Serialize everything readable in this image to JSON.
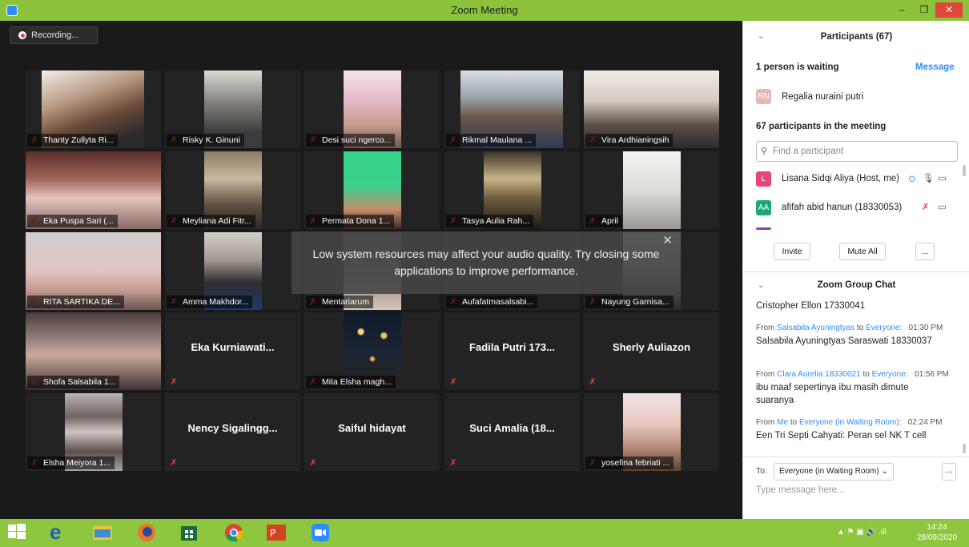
{
  "window": {
    "title": "Zoom Meeting",
    "minimize": "–",
    "maximize": "❐",
    "close": "✕"
  },
  "recording": {
    "label": "Recording..."
  },
  "tiles": [
    {
      "name": "Thanty Zullyta Ri..."
    },
    {
      "name": "Risky K. Ginuni"
    },
    {
      "name": "Desi suci ngerco..."
    },
    {
      "name": "Rikmal Maulana ..."
    },
    {
      "name": "Vira Ardhianingsih"
    },
    {
      "name": "Eka Puspa Sari (..."
    },
    {
      "name": "Meyliana Adi Fitr..."
    },
    {
      "name": "Permata Dona 1..."
    },
    {
      "name": "Tasya Aulia Rah..."
    },
    {
      "name": "April"
    },
    {
      "name": "RITA SARTIKA DE..."
    },
    {
      "name": "Amma Makhdor..."
    },
    {
      "name": "Mentariarum"
    },
    {
      "name": "Aufafatmasalsabi..."
    },
    {
      "name": "Nayung Garnisa..."
    },
    {
      "name": "Shofa Salsabila 1..."
    },
    {
      "display": "Eka Kurniawati..."
    },
    {
      "name": "Mita Elsha magh..."
    },
    {
      "display": "Fadila Putri 173..."
    },
    {
      "display": "Sherly Auliazon"
    },
    {
      "name": "Elsha Meiyora 1..."
    },
    {
      "display": "Nency Sigalingg..."
    },
    {
      "display": "Saiful hidayat"
    },
    {
      "display": "Suci Amalia (18..."
    },
    {
      "name": "yosefina febriati ..."
    }
  ],
  "notice": {
    "text": "Low system resources may affect your audio quality. Try closing some applications to improve performance.",
    "close": "✕"
  },
  "participants": {
    "header": "Participants (67)",
    "waiting_title": "1 person is waiting",
    "message_label": "Message",
    "waiting_person": {
      "initials": "RN",
      "name": "Regalia nuraini putri"
    },
    "in_meeting_title": "67 participants in the meeting",
    "search_placeholder": "Find a participant",
    "list": [
      {
        "initials": "L",
        "name": "Lisana Sidqi Aliya (Host, me)",
        "color": "#e8457a"
      },
      {
        "initials": "AA",
        "name": "afifah abid hanun (18330053)",
        "color": "#1aa87b"
      }
    ],
    "invite": "Invite",
    "mute_all": "Mute All",
    "more": "..."
  },
  "chat": {
    "header": "Zoom Group Chat",
    "cut_line": "Cristopher Ellon 17330041",
    "messages": [
      {
        "from": "Salsabila Ayuningtyas",
        "to": "Everyone",
        "time": "01:30 PM",
        "text": "Salsabila Ayuningtyas Saraswati 18330037"
      },
      {
        "from": "Clara Aurelia 18330021",
        "to": "Everyone",
        "time": "01:56 PM",
        "text": "ibu maaf sepertinya ibu masih dimute suaranya"
      },
      {
        "from": "Me",
        "to": "Everyone (in Waiting Room)",
        "time": "02:24 PM",
        "text": "Een Tri Septi Cahyati: Peran sel NK T cell"
      }
    ],
    "from_label": "From",
    "to_label": "to",
    "to_prefix": "To:",
    "recipient": "Everyone (in Waiting Room)",
    "input_placeholder": "Type message here...",
    "more": "···"
  },
  "taskbar": {
    "time": "14:24",
    "date": "28/09/2020"
  }
}
